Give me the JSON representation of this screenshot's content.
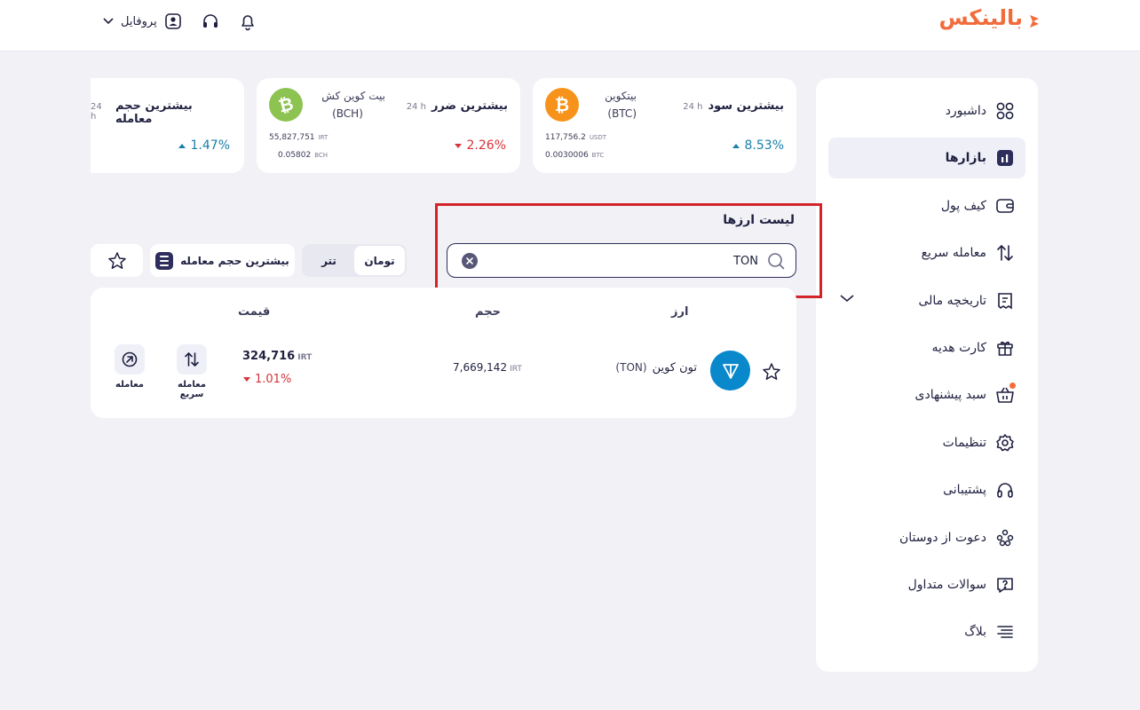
{
  "header": {
    "logo_text": "بالینکس",
    "profile_label": "پروفایل",
    "icons": [
      "bell-icon",
      "headphones-icon",
      "user-icon",
      "chevron-down-icon"
    ]
  },
  "sidebar": {
    "items": [
      {
        "label": "داشبورد",
        "icon": "dashboard-grid-icon"
      },
      {
        "label": "بازارها",
        "icon": "markets-icon",
        "active": true
      },
      {
        "label": "کیف پول",
        "icon": "wallet-icon"
      },
      {
        "label": "معامله سریع",
        "icon": "swap-arrows-icon"
      },
      {
        "label": "تاریخچه مالی",
        "icon": "receipt-icon",
        "expandable": true
      },
      {
        "label": "کارت هدیه",
        "icon": "gift-icon"
      },
      {
        "label": "سبد پیشنهادی",
        "icon": "basket-icon",
        "badge_dot": true
      },
      {
        "label": "تنظیمات",
        "icon": "gear-icon"
      },
      {
        "label": "پشتیبانی",
        "icon": "headphones-icon"
      },
      {
        "label": "دعوت از دوستان",
        "icon": "people-icon"
      },
      {
        "label": "سوالات متداول",
        "icon": "question-icon"
      },
      {
        "label": "بلاگ",
        "icon": "blog-lines-icon"
      }
    ]
  },
  "cards": [
    {
      "title": "بیشترین سود",
      "period": "24 h",
      "coin_name": "بیتکوین",
      "coin_symbol": "(BTC)",
      "price": "117,756.2",
      "price_unit": "USDT",
      "amount": "0.0030006",
      "amount_unit": "BTC",
      "change": "8.53%",
      "direction": "up",
      "icon": "bitcoin-icon",
      "color": "#f7931a"
    },
    {
      "title": "بیشترین ضرر",
      "period": "24 h",
      "coin_name": "بیت کوین کش",
      "coin_symbol": "(BCH)",
      "price": "55,827,751",
      "price_unit": "IRT",
      "amount": "0.05802",
      "amount_unit": "BCH",
      "change": "2.26%",
      "direction": "down",
      "icon": "bitcoin-cash-icon",
      "color": "#8dc351"
    },
    {
      "title": "بیشترین حجم معامله",
      "period": "24 h",
      "change": "1.47%",
      "direction": "up"
    }
  ],
  "list": {
    "title": "لیست ارزها",
    "search_value": "TON",
    "currency_tabs": [
      "تومان",
      "تتر"
    ],
    "active_tab": "تومان",
    "sort_label": "بیشترین حجم معامله",
    "columns": {
      "coin": "ارز",
      "volume": "حجم",
      "price": "قیمت"
    },
    "rows": [
      {
        "name": "تون کوین",
        "symbol": "(TON)",
        "volume": "7,669,142",
        "volume_unit": "IRT",
        "price": "324,716",
        "price_unit": "IRT",
        "change": "1.01%",
        "direction": "down",
        "actions": [
          "معامله سریع",
          "معامله"
        ]
      }
    ]
  },
  "colors": {
    "brand": "#f26b3a",
    "primary": "#2d2e5c",
    "up": "#1a7fa8",
    "down": "#d6333a",
    "highlight": "#d3242c"
  }
}
